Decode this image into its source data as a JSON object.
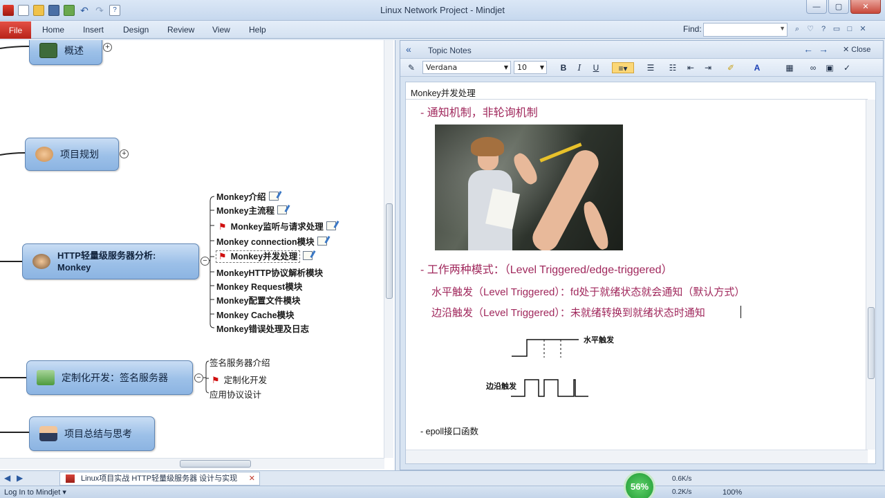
{
  "window": {
    "title": "Linux Network Project - Mindjet"
  },
  "ribbon": {
    "file": "File",
    "tabs": [
      "Home",
      "Insert",
      "Design",
      "Review",
      "View",
      "Help"
    ],
    "find_label": "Find:"
  },
  "map": {
    "nodes": [
      {
        "label": "概述"
      },
      {
        "label": "项目规划"
      },
      {
        "label_line1": "HTTP轻量级服务器分析:",
        "label_line2": "Monkey"
      },
      {
        "label": "定制化开发：签名服务器"
      },
      {
        "label": "项目总结与思考"
      }
    ],
    "http_subtopics": [
      "Monkey介绍",
      "Monkey主流程",
      "Monkey监听与请求处理",
      "Monkey connection模块",
      "Monkey并发处理",
      "MonkeyHTTP协议解析模块",
      "Monkey Request模块",
      "Monkey配置文件模块",
      "Monkey Cache模块",
      "Monkey错误处理及日志"
    ],
    "sign_subtopics": [
      "签名服务器介绍",
      "定制化开发",
      "应用协议设计"
    ]
  },
  "notes": {
    "header_title": "Topic Notes",
    "close_label": "Close",
    "font_name": "Verdana",
    "font_size": "10",
    "doc_title": "Monkey并发处理",
    "bullet1": "- 通知机制，非轮询机制",
    "bullet2": "- 工作两种模式：（Level Triggered/edge-triggered）",
    "line_level": "水平触发（Level Triggered）：fd处于就绪状态就会通知（默认方式）",
    "line_edge": "边沿触发（Level Triggered）：未就绪转换到就绪状态时通知",
    "diagram_label_level": "水平触发",
    "diagram_label_edge": "边沿触发",
    "bullet3": "- epoll接口函数"
  },
  "bottom": {
    "doc_tab": "Linux项目实战 HTTP轻量级服务器 设计与实现",
    "login": "Log In to Mindjet",
    "gauge": "56%",
    "net_up": "0.6K/s",
    "net_down": "0.2K/s",
    "zoom": "100%"
  },
  "colors": {
    "note_text": "#a0285c",
    "node_fill": "#9cc0e8",
    "file_tab": "#c8312a"
  }
}
